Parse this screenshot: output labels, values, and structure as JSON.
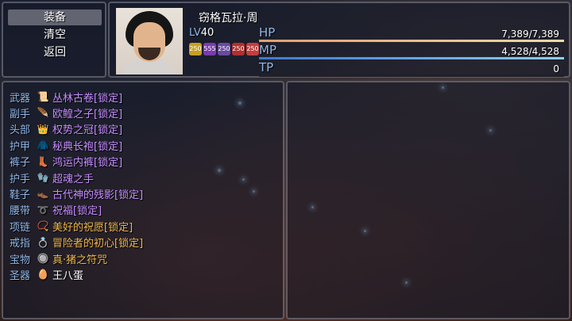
{
  "command_menu": {
    "items": [
      {
        "label": "装备",
        "selected": true
      },
      {
        "label": "清空",
        "selected": false
      },
      {
        "label": "返回",
        "selected": false
      }
    ]
  },
  "status": {
    "name": "窃格瓦拉·周",
    "level_label": "LV",
    "level": "40",
    "states": [
      {
        "icon": "gold-buff-icon",
        "color": "#c8a020",
        "text": "250"
      },
      {
        "icon": "purple-buff-icon",
        "color": "#7a3ab0",
        "text": "555"
      },
      {
        "icon": "purple-buff-icon",
        "color": "#6a4aa0",
        "text": "250"
      },
      {
        "icon": "red-buff-icon",
        "color": "#b03030",
        "text": "250"
      },
      {
        "icon": "red-buff-icon",
        "color": "#c04040",
        "text": "250"
      }
    ],
    "hp": {
      "label": "HP",
      "value": "7,389/7,389",
      "ratio": 1.0,
      "color": "#e0a070"
    },
    "mp": {
      "label": "MP",
      "value": "4,528/4,528",
      "ratio": 1.0,
      "color": "#4aa0e0"
    },
    "tp": {
      "label": "TP",
      "value": "0",
      "ratio": 0.0,
      "color": "#40c060"
    }
  },
  "equipment": {
    "slots": [
      {
        "type": "武器",
        "icon": "scroll-icon",
        "glyph": "📜",
        "name": "丛林古卷",
        "suffix": "[锁定]",
        "color": "purple"
      },
      {
        "type": "副手",
        "icon": "feather-icon",
        "glyph": "🪶",
        "name": "欧鳇之子",
        "suffix": "[锁定]",
        "color": "purple"
      },
      {
        "type": "头部",
        "icon": "crown-icon",
        "glyph": "👑",
        "name": "权势之冠",
        "suffix": "[锁定]",
        "color": "purple"
      },
      {
        "type": "护甲",
        "icon": "robe-icon",
        "glyph": "🧥",
        "name": "秘典长袍",
        "suffix": "[锁定]",
        "color": "purple"
      },
      {
        "type": "裤子",
        "icon": "boot-icon",
        "glyph": "👢",
        "name": "鸿运内裤",
        "suffix": "[锁定]",
        "color": "purple"
      },
      {
        "type": "护手",
        "icon": "glove-icon",
        "glyph": "🧤",
        "name": "超魂之手",
        "suffix": "",
        "color": "purple"
      },
      {
        "type": "鞋子",
        "icon": "shoe-icon",
        "glyph": "👞",
        "name": "古代神的残影",
        "suffix": "[锁定]",
        "color": "purple"
      },
      {
        "type": "腰带",
        "icon": "belt-icon",
        "glyph": "➰",
        "name": "祝福",
        "suffix": "[锁定]",
        "color": "purple"
      },
      {
        "type": "项链",
        "icon": "necklace-icon",
        "glyph": "📿",
        "name": "美好的祝愿",
        "suffix": "[锁定]",
        "color": "orange"
      },
      {
        "type": "戒指",
        "icon": "ring-icon",
        "glyph": "💍",
        "name": "冒险者的初心",
        "suffix": "[锁定]",
        "color": "orange"
      },
      {
        "type": "宝物",
        "icon": "talisman-icon",
        "glyph": "🔘",
        "name": "真·猪之符咒",
        "suffix": "",
        "color": "orange"
      },
      {
        "type": "圣器",
        "icon": "egg-icon",
        "glyph": "🥚",
        "name": "王八蛋",
        "suffix": "",
        "color": "white"
      }
    ]
  }
}
